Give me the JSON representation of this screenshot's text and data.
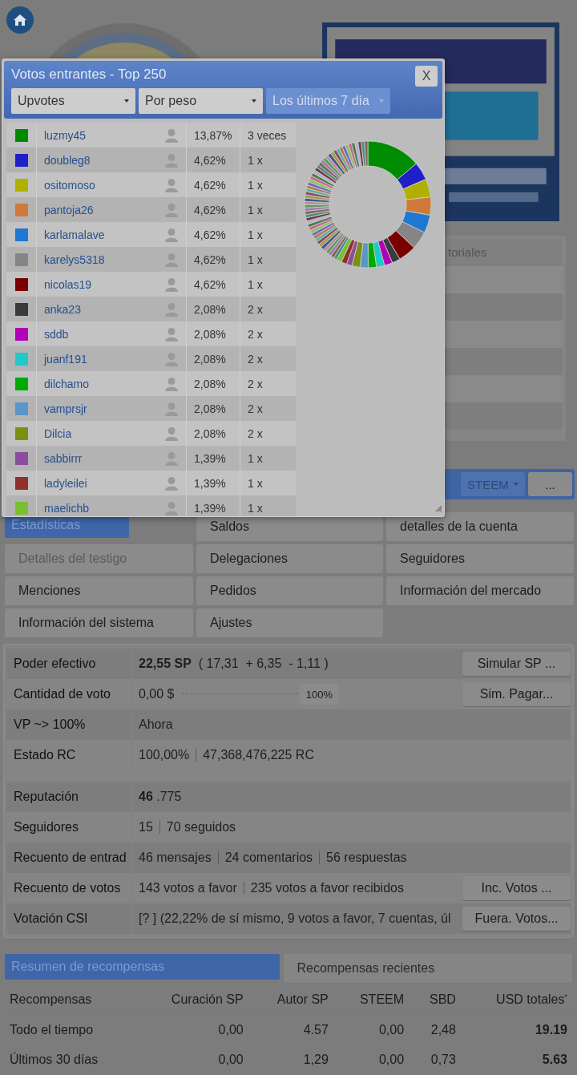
{
  "side_panel": {
    "tab": "toriales"
  },
  "toolbar": {
    "currency": "STEEM",
    "more": "..."
  },
  "nav_buttons": [
    {
      "label": "Estadísticas",
      "selected": true,
      "disabled": false
    },
    {
      "label": "Saldos",
      "selected": false,
      "disabled": false
    },
    {
      "label": "detalles de la cuenta",
      "selected": false,
      "disabled": false
    },
    {
      "label": "Detalles del testigo",
      "selected": false,
      "disabled": true
    },
    {
      "label": "Delegaciones",
      "selected": false,
      "disabled": false
    },
    {
      "label": "Seguidores",
      "selected": false,
      "disabled": false
    },
    {
      "label": "Menciones",
      "selected": false,
      "disabled": false
    },
    {
      "label": "Pedidos",
      "selected": false,
      "disabled": false
    },
    {
      "label": "Información del mercado",
      "selected": false,
      "disabled": false
    },
    {
      "label": "Información del sistema",
      "selected": false,
      "disabled": false
    },
    {
      "label": "Ajustes",
      "selected": false,
      "disabled": false
    }
  ],
  "stats_groups": [
    {
      "rows": [
        {
          "label": "Poder efectivo",
          "kind": "text",
          "parts": [
            "**22,55 SP**  ( 17,31  + 6,35  - 1,11 )"
          ],
          "button": "Simular SP ..."
        },
        {
          "label": "Cantidad de voto",
          "kind": "slider",
          "parts": [
            "0,00 $"
          ],
          "level": 1,
          "reading": "100%",
          "button": "Sim. Pagar..."
        },
        {
          "label": "VP ~> 100%",
          "kind": "text",
          "parts": [
            "Ahora"
          ]
        },
        {
          "label": "Estado RC",
          "kind": "text",
          "parts": [
            "100,00%",
            "47,368,476,225 RC"
          ]
        }
      ]
    },
    {
      "rows": [
        {
          "label": "Reputación",
          "kind": "text",
          "parts": [
            "**46** .775"
          ]
        },
        {
          "label": "Seguidores",
          "kind": "text",
          "parts": [
            "15",
            "70 seguidos"
          ]
        },
        {
          "label": "Recuento de entrad",
          "kind": "text",
          "parts": [
            "46 mensajes",
            "24 comentarios",
            "56 respuestas"
          ]
        },
        {
          "label": "Recuento de votos",
          "kind": "text",
          "parts": [
            "143 votos a favor",
            "235 votos a favor recibidos"
          ],
          "button": "Inc. Votos ..."
        },
        {
          "label": "Votación CSI",
          "kind": "text",
          "parts": [
            "[? ] (22,22% de sí mismo, 9 votos a favor, 7 cuentas, úl"
          ],
          "button": "Fuera. Votos..."
        }
      ]
    }
  ],
  "rewards": {
    "tabs": [
      {
        "label": "Resumen de recompensas",
        "selected": true
      },
      {
        "label": "Recompensas recientes",
        "selected": false
      }
    ],
    "columns": [
      "Recompensas",
      "Curación SP",
      "Autor SP",
      "STEEM",
      "SBD",
      "USD totales$^{*}$"
    ],
    "rows": [
      [
        "Todo el tiempo",
        "0,00",
        "4.57",
        "0,00",
        "2,48",
        "19.19"
      ],
      [
        "Últimos 30 días",
        "0,00",
        "1,29",
        "0,00",
        "0,73",
        "5.63"
      ]
    ]
  },
  "popup": {
    "title": "Votos entrantes - Top 250",
    "close": "X",
    "selects": [
      {
        "value": "Upvotes",
        "disabled": false
      },
      {
        "value": "Por peso",
        "disabled": false
      },
      {
        "value": "Los últimos 7 día",
        "disabled": true
      }
    ],
    "voters": [
      {
        "name": "luzmy45",
        "color": "#008c00",
        "pct": "13,87%",
        "count": "3 veces"
      },
      {
        "name": "doubleg8",
        "color": "#1f1fc8",
        "pct": "4,62%",
        "count": "1 x"
      },
      {
        "name": "ositomoso",
        "color": "#b0b000",
        "pct": "4,62%",
        "count": "1 x"
      },
      {
        "name": "pantoja26",
        "color": "#d07a3a",
        "pct": "4,62%",
        "count": "1 x"
      },
      {
        "name": "karlamalave",
        "color": "#1e78d2",
        "pct": "4,62%",
        "count": "1 x"
      },
      {
        "name": "karelys5318",
        "color": "#858585",
        "pct": "4,62%",
        "count": "1 x"
      },
      {
        "name": "nicolas19",
        "color": "#780000",
        "pct": "4,62%",
        "count": "1 x"
      },
      {
        "name": "anka23",
        "color": "#3a3a3a",
        "pct": "2,08%",
        "count": "2 x"
      },
      {
        "name": "sddb",
        "color": "#b000b8",
        "pct": "2,08%",
        "count": "2 x"
      },
      {
        "name": "juanf191",
        "color": "#20c8c8",
        "pct": "2,08%",
        "count": "2 x"
      },
      {
        "name": "dilchamo",
        "color": "#00aa00",
        "pct": "2,08%",
        "count": "2 x"
      },
      {
        "name": "vamprsjr",
        "color": "#5a96c8",
        "pct": "2,08%",
        "count": "2 x"
      },
      {
        "name": "Dilcia",
        "color": "#7a9010",
        "pct": "2,08%",
        "count": "2 x"
      },
      {
        "name": "sabbirrr",
        "color": "#8c4c9c",
        "pct": "1,39%",
        "count": "1 x"
      },
      {
        "name": "ladyleilei",
        "color": "#90302a",
        "pct": "1,39%",
        "count": "1 x"
      },
      {
        "name": "maelichb",
        "color": "#78c030",
        "pct": "1,39%",
        "count": "1 x"
      }
    ]
  }
}
